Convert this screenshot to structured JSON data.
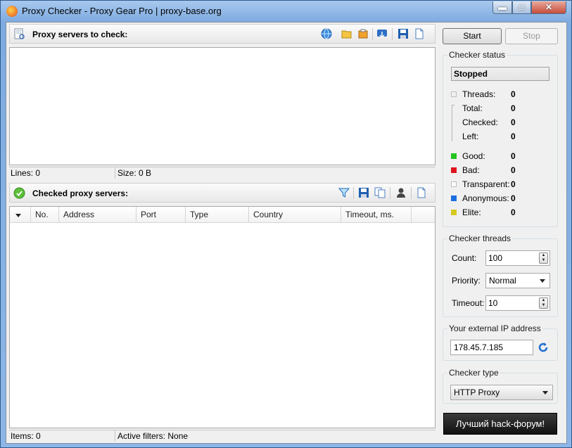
{
  "window": {
    "title": "Proxy Checker - Proxy Gear Pro | proxy-base.org"
  },
  "proxy_list": {
    "header": "Proxy servers to check:",
    "status": {
      "lines": "Lines: 0",
      "size": "Size: 0 B"
    }
  },
  "checked": {
    "header": "Checked proxy servers:",
    "columns": [
      "No.",
      "Address",
      "Port",
      "Type",
      "Country",
      "Timeout, ms."
    ],
    "status": {
      "items": "Items: 0",
      "filters": "Active filters: None"
    }
  },
  "controls": {
    "start": "Start",
    "stop": "Stop"
  },
  "checker_status": {
    "legend": "Checker status",
    "state": "Stopped",
    "rows": [
      {
        "label": "Threads:",
        "value": "0"
      },
      {
        "label": "Total:",
        "value": "0"
      },
      {
        "label": "Checked:",
        "value": "0"
      },
      {
        "label": "Left:",
        "value": "0"
      },
      {
        "label": "Good:",
        "value": "0",
        "color": "#22c41e"
      },
      {
        "label": "Bad:",
        "value": "0",
        "color": "#e0141b"
      },
      {
        "label": "Transparent:",
        "value": "0",
        "color": "#ffffff"
      },
      {
        "label": "Anonymous:",
        "value": "0",
        "color": "#1a6fe0"
      },
      {
        "label": "Elite:",
        "value": "0",
        "color": "#d6c81d"
      }
    ]
  },
  "threads": {
    "legend": "Checker threads",
    "count_label": "Count:",
    "count": "100",
    "priority_label": "Priority:",
    "priority": "Normal",
    "timeout_label": "Timeout:",
    "timeout": "10"
  },
  "external_ip": {
    "legend": "Your external IP address",
    "value": "178.45.7.185"
  },
  "checker_type": {
    "legend": "Checker type",
    "value": "HTTP Proxy"
  },
  "promo": {
    "text": "Лучший hack-форум!"
  }
}
